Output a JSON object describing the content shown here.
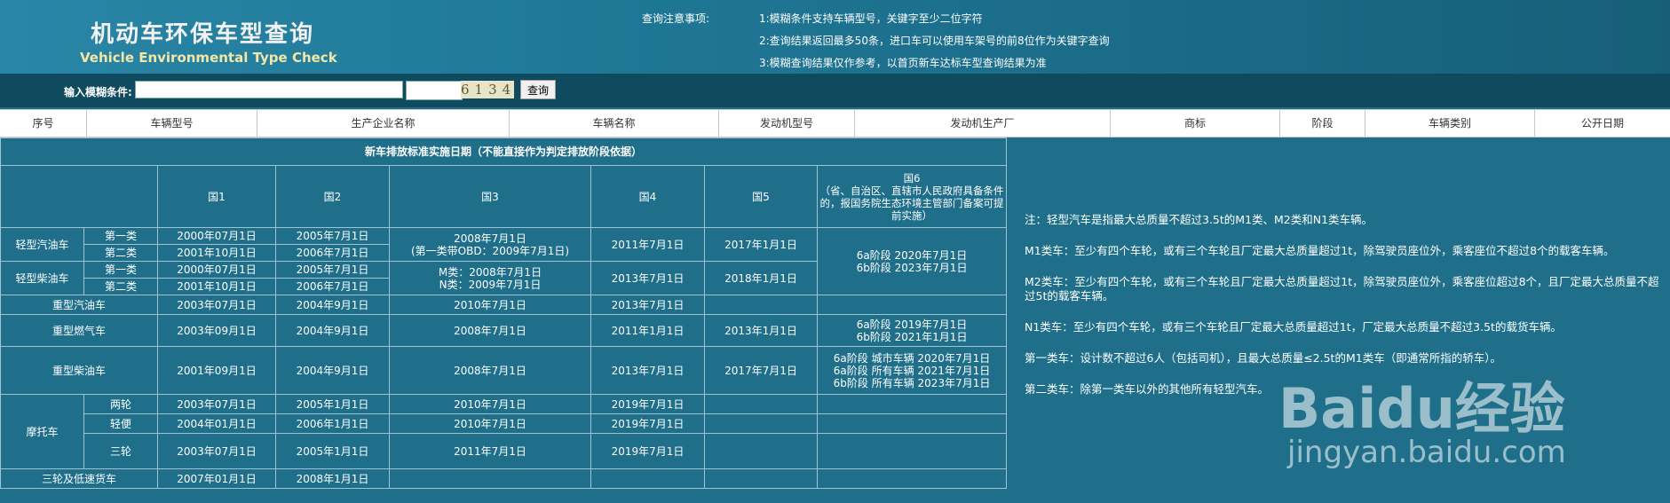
{
  "header": {
    "title_zh": "机动车环保车型查询",
    "title_en": "Vehicle Environmental Type Check",
    "notes_title": "查询注意事项:",
    "notes": [
      "1:模糊条件支持车辆型号，关键字至少二位字符",
      "2:查询结果返回最多50条，进口车可以使用车架号的前8位作为关键字查询",
      "3:模糊查询结果仅作参考，以首页新车达标车型查询结果为准"
    ]
  },
  "search": {
    "label": "输入模糊条件:",
    "value": "",
    "code_value": "",
    "captcha": "6134",
    "button": "查询"
  },
  "columns": [
    "序号",
    "车辆型号",
    "生产企业名称",
    "车辆名称",
    "发动机型号",
    "发动机生产厂",
    "商标",
    "阶段",
    "车辆类别",
    "公开日期"
  ],
  "standards": {
    "caption": "新车排放标准实施日期（不能直接作为判定排放阶段依据）",
    "headers": [
      "国1",
      "国2",
      "国3",
      "国4",
      "国5",
      "国6\n（省、自治区、直辖市人民政府具备条件的，报国务院生态环境主管部门备案可提前实施）"
    ],
    "rows": {
      "lg_gas": "轻型汽油车",
      "lg_diesel": "轻型柴油车",
      "cls1": "第一类",
      "cls2": "第二类",
      "heavy_gas": "重型汽油车",
      "heavy_ng": "重型燃气车",
      "heavy_diesel": "重型柴油车",
      "moto": "摩托车",
      "moto_2w": "两轮",
      "moto_light": "轻便",
      "moto_3w": "三轮",
      "tri_low": "三轮及低速货车"
    },
    "cells": {
      "lgg1_g1": "2000年07月1日",
      "lgg1_g2": "2005年7月1日",
      "lgg2_g1": "2001年10月1日",
      "lgg2_g2": "2006年7月1日",
      "lgg_g3": "2008年7月1日\n(第一类带OBD：2009年7月1日)",
      "lgg_g4": "2011年7月1日",
      "lgg_g5": "2017年1月1日",
      "lg_g6": "6a阶段 2020年7月1日\n6b阶段 2023年7月1日",
      "lgd1_g1": "2000年07月1日",
      "lgd1_g2": "2005年7月1日",
      "lgd2_g1": "2001年10月1日",
      "lgd2_g2": "2006年7月1日",
      "lgd_g3": "M类：2008年7月1日\nN类：2009年7月1日",
      "lgd_g4": "2013年7月1日",
      "lgd_g5": "2018年1月1日",
      "hg_g1": "2003年07月1日",
      "hg_g2": "2004年9月1日",
      "hg_g3": "2010年7月1日",
      "hg_g4": "2013年7月1日",
      "hng_g1": "2003年09月1日",
      "hng_g2": "2004年9月1日",
      "hng_g3": "2008年7月1日",
      "hng_g4": "2011年1月1日",
      "hng_g5": "2013年1月1日",
      "hng_g6": "6a阶段 2019年7月1日\n6b阶段 2021年1月1日",
      "hd_g1": "2001年09月1日",
      "hd_g2": "2004年9月1日",
      "hd_g3": "2008年7月1日",
      "hd_g4": "2013年7月1日",
      "hd_g5": "2017年7月1日",
      "hd_g6": "6a阶段 城市车辆 2020年7月1日\n6a阶段 所有车辆 2021年7月1日\n6b阶段 所有车辆 2023年7月1日",
      "m2_g1": "2003年07月1日",
      "m2_g2": "2005年1月1日",
      "m2_g3": "2010年7月1日",
      "m2_g4": "2019年7月1日",
      "ml_g1": "2004年01月1日",
      "ml_g2": "2006年1月1日",
      "ml_g3": "2010年7月1日",
      "ml_g4": "2019年7月1日",
      "m3_g1": "2003年07月1日",
      "m3_g2": "2005年1月1日",
      "m3_g3": "2011年7月1日",
      "m3_g4": "2019年7月1日",
      "tl_g1": "2007年01月1日",
      "tl_g2": "2008年1月1日"
    }
  },
  "side_notes": [
    "注：轻型汽车是指最大总质量不超过3.5t的M1类、M2类和N1类车辆。",
    "M1类车：至少有四个车轮，或有三个车轮且厂定最大总质量超过1t，除驾驶员座位外，乘客座位不超过8个的载客车辆。",
    "M2类车：至少有四个车轮，或有三个车轮且厂定最大总质量超过1t，除驾驶员座位外，乘客座位超过8个，且厂定最大总质量不超过5t的载客车辆。",
    "N1类车：至少有四个车轮，或有三个车轮且厂定最大总质量超过1t，厂定最大总质量不超过3.5t的载货车辆。",
    "第一类车：设计数不超过6人（包括司机），且最大总质量≤2.5t的M1类车（即通常所指的轿车）。",
    "第二类车：除第一类车以外的其他所有轻型汽车。"
  ],
  "watermark": {
    "brand": "Baidu经验",
    "url": "jingyan.baidu.com"
  },
  "colors": {
    "background": "#1f6f8b",
    "searchbar": "#0f4a5f",
    "accent_en_title": "#f3e7a8"
  }
}
